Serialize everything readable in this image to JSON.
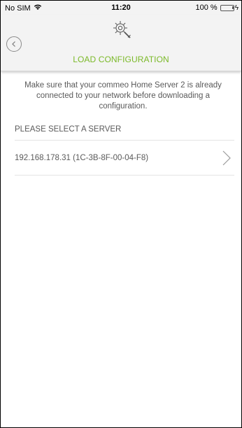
{
  "status_bar": {
    "carrier": "No SIM",
    "time": "11:20",
    "battery_percent": "100 %",
    "battery_level": 1.0
  },
  "header": {
    "title": "LOAD CONFIGURATION"
  },
  "content": {
    "info_text": "Make sure that your commeo Home Server 2 is already connected to your network before downloading a configuration.",
    "section_label": "PLEASE SELECT A SERVER",
    "servers": [
      {
        "label": "192.168.178.31 (1C-3B-8F-00-04-F8)"
      }
    ]
  },
  "colors": {
    "accent": "#7bb928",
    "header_bg": "#f3f3f3",
    "text": "#5a5a5a"
  }
}
